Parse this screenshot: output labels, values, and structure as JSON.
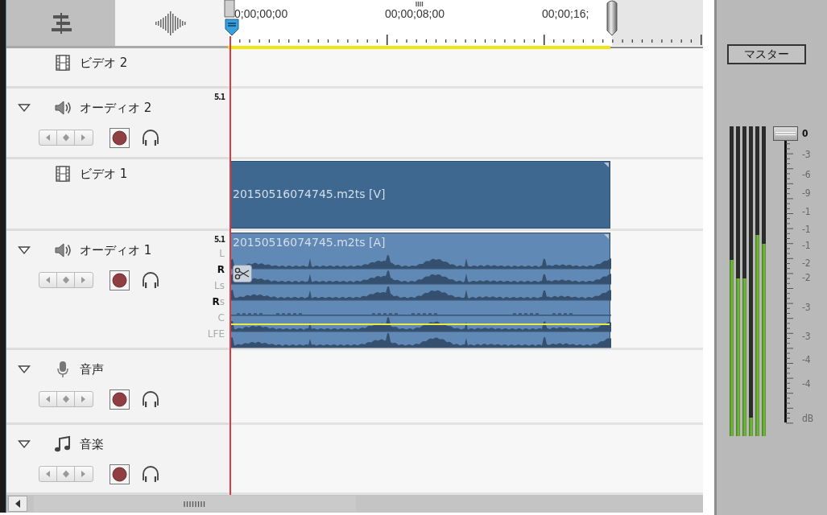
{
  "view_tabs": [
    {
      "kind": "timeline",
      "selected": true
    },
    {
      "kind": "waveform",
      "selected": false
    }
  ],
  "ruler": {
    "timecodes": [
      "0;00;00;00",
      "00;00;08;00",
      "00;00;16;"
    ]
  },
  "tracks": [
    {
      "kind": "video",
      "name": "ビデオ 2"
    },
    {
      "kind": "audio",
      "name": "オーディオ 2",
      "expanded": true,
      "channel_format": "5.1"
    },
    {
      "kind": "video",
      "name": "ビデオ 1",
      "clip": {
        "label": "20150516074745.m2ts [V]"
      }
    },
    {
      "kind": "audio",
      "name": "オーディオ 1",
      "expanded": true,
      "channel_format": "5.1",
      "channels": [
        {
          "label": "L",
          "bold": false
        },
        {
          "label": "R",
          "bold": true
        },
        {
          "label": "Ls",
          "bold": false
        },
        {
          "label": "**R**s",
          "bold": false
        },
        {
          "label": "C",
          "bold": false
        },
        {
          "label": "LFE",
          "bold": false
        }
      ],
      "clip": {
        "label": "20150516074745.m2ts [A]"
      }
    },
    {
      "kind": "voice",
      "name": "音声",
      "expanded": true
    },
    {
      "kind": "music",
      "name": "音楽",
      "expanded": true
    }
  ],
  "mixer": {
    "title": "マスター",
    "meters": [
      {
        "level": 0.57
      },
      {
        "level": 0.51
      },
      {
        "level": 0.51
      },
      {
        "level": 0.06
      },
      {
        "level": 0.65
      },
      {
        "level": 0.62
      }
    ],
    "fader": {
      "level": 1
    },
    "scale": [
      "0",
      "-3",
      "-6",
      "-9",
      "-1",
      "-1",
      "-1",
      "-2",
      "-2",
      "-3",
      "-3",
      "-4",
      "-4",
      "dB"
    ]
  }
}
